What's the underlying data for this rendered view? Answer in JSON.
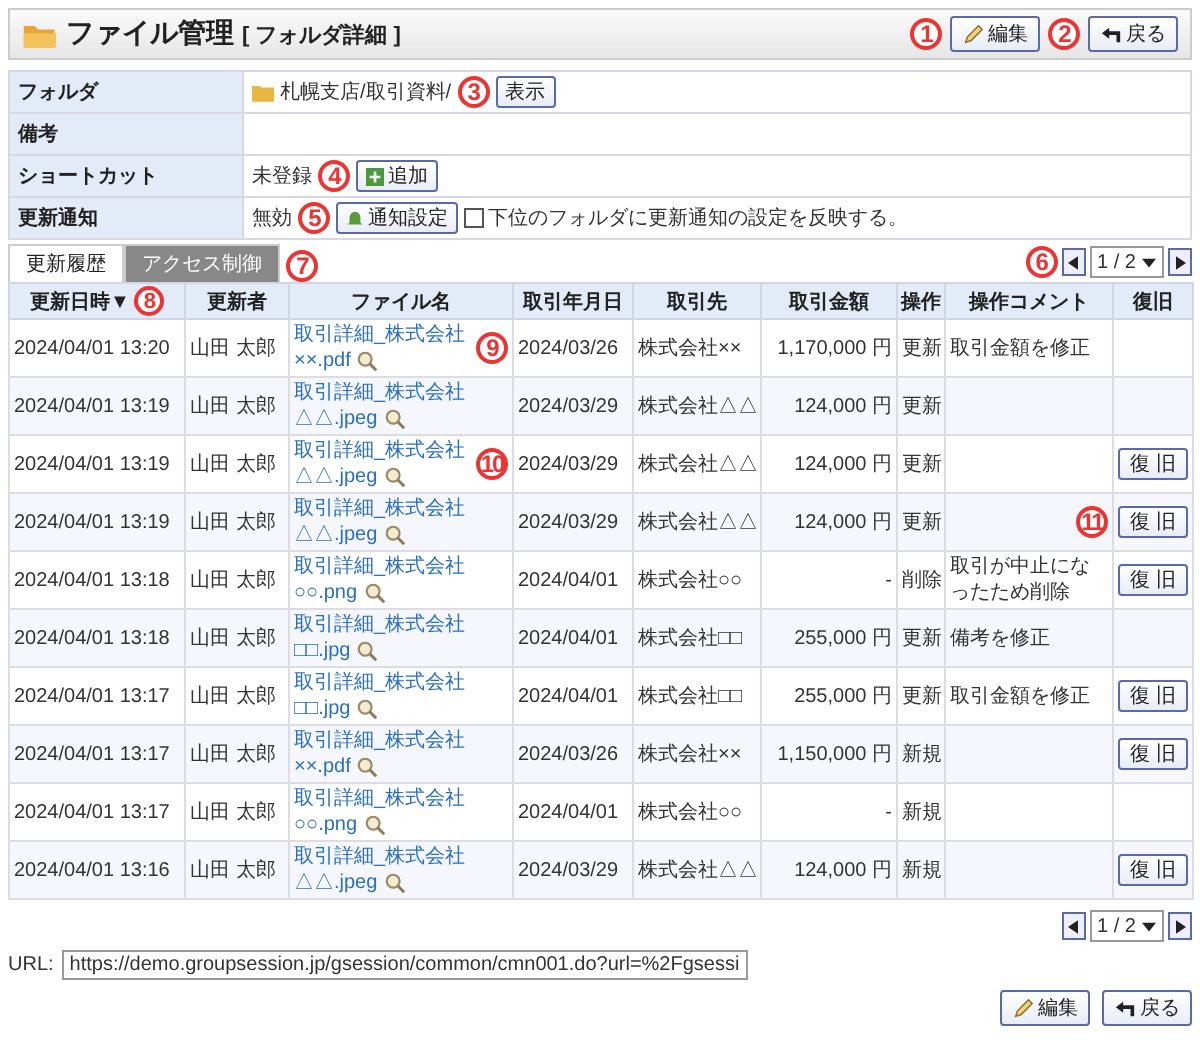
{
  "header": {
    "title": "ファイル管理",
    "subtitle": "[ フォルダ詳細 ]",
    "buttons": [
      {
        "kind": "edit",
        "label": "編集"
      },
      {
        "kind": "back",
        "label": "戻る"
      }
    ]
  },
  "info": [
    {
      "kind": "folder",
      "label": "フォルダ",
      "value": "札幌支店/取引資料/",
      "button": "表示"
    },
    {
      "kind": "text",
      "label": "備考"
    },
    {
      "kind": "shortcut",
      "label": "ショートカット",
      "value": "未登録",
      "button": "追加"
    },
    {
      "kind": "notify",
      "label": "更新通知",
      "value": "無効",
      "button": "通知設定",
      "checkbox": {
        "label": "下位のフォルダに更新通知の設定を反映する。",
        "checked": false
      }
    }
  ],
  "tabs": [
    {
      "label": "更新履歴",
      "selected": true
    },
    {
      "label": "アクセス制御",
      "selected": false
    }
  ],
  "pager_top": {
    "page": "1 / 2"
  },
  "columns": [
    {
      "label": "更新日時",
      "sort_mark": "▼"
    },
    {
      "label": "更新者"
    },
    {
      "label": "ファイル名"
    },
    {
      "label": "取引年月日"
    },
    {
      "label": "取引先"
    },
    {
      "label": "取引金額"
    },
    {
      "label": "操作"
    },
    {
      "label": "操作コメント"
    },
    {
      "label": "復旧"
    }
  ],
  "rows": [
    {
      "updated": "2024/04/01 13:20",
      "user": "山田 太郎",
      "file": "取引詳細_株式会社××.pdf",
      "date": "2024/03/26",
      "client": "株式会社××",
      "amount": "1,170,000 円",
      "op": "更新",
      "comment": "取引金額を修正"
    },
    {
      "updated": "2024/04/01 13:19",
      "user": "山田 太郎",
      "file": "取引詳細_株式会社△△.jpeg",
      "date": "2024/03/29",
      "client": "株式会社△△",
      "amount": "124,000 円",
      "op": "更新"
    },
    {
      "updated": "2024/04/01 13:19",
      "user": "山田 太郎",
      "file": "取引詳細_株式会社△△.jpeg",
      "date": "2024/03/29",
      "client": "株式会社△△",
      "amount": "124,000 円",
      "op": "更新",
      "restore": "復 旧"
    },
    {
      "updated": "2024/04/01 13:19",
      "user": "山田 太郎",
      "file": "取引詳細_株式会社△△.jpeg",
      "date": "2024/03/29",
      "client": "株式会社△△",
      "amount": "124,000 円",
      "op": "更新",
      "restore": "復 旧"
    },
    {
      "updated": "2024/04/01 13:18",
      "user": "山田 太郎",
      "file": "取引詳細_株式会社○○.png",
      "date": "2024/04/01",
      "client": "株式会社○○",
      "amount": "-",
      "op": "削除",
      "comment": "取引が中止になったため削除",
      "restore": "復 旧"
    },
    {
      "updated": "2024/04/01 13:18",
      "user": "山田 太郎",
      "file": "取引詳細_株式会社□□.jpg",
      "date": "2024/04/01",
      "client": "株式会社□□",
      "amount": "255,000 円",
      "op": "更新",
      "comment": "備考を修正"
    },
    {
      "updated": "2024/04/01 13:17",
      "user": "山田 太郎",
      "file": "取引詳細_株式会社□□.jpg",
      "date": "2024/04/01",
      "client": "株式会社□□",
      "amount": "255,000 円",
      "op": "更新",
      "comment": "取引金額を修正",
      "restore": "復 旧"
    },
    {
      "updated": "2024/04/01 13:17",
      "user": "山田 太郎",
      "file": "取引詳細_株式会社××.pdf",
      "date": "2024/03/26",
      "client": "株式会社××",
      "amount": "1,150,000 円",
      "op": "新規",
      "restore": "復 旧"
    },
    {
      "updated": "2024/04/01 13:17",
      "user": "山田 太郎",
      "file": "取引詳細_株式会社○○.png",
      "date": "2024/04/01",
      "client": "株式会社○○",
      "amount": "-",
      "op": "新規"
    },
    {
      "updated": "2024/04/01 13:16",
      "user": "山田 太郎",
      "file": "取引詳細_株式会社△△.jpeg",
      "date": "2024/03/29",
      "client": "株式会社△△",
      "amount": "124,000 円",
      "op": "新規",
      "restore": "復 旧"
    }
  ],
  "pager_bottom": {
    "page": "1 / 2"
  },
  "url": {
    "label": "URL:",
    "value": "https://demo.groupsession.jp/gsession/common/cmn001.do?url=%2Fgsessi"
  },
  "footer_buttons": [
    {
      "kind": "edit",
      "label": "編集"
    },
    {
      "kind": "back",
      "label": "戻る"
    }
  ],
  "markers": [
    {
      "number": "1"
    },
    {
      "number": "2"
    },
    {
      "number": "3"
    },
    {
      "number": "4"
    },
    {
      "number": "5"
    },
    {
      "number": "6"
    },
    {
      "number": "7"
    },
    {
      "number": "8"
    },
    {
      "number": "9"
    },
    {
      "number": "10"
    },
    {
      "number": "11"
    }
  ]
}
